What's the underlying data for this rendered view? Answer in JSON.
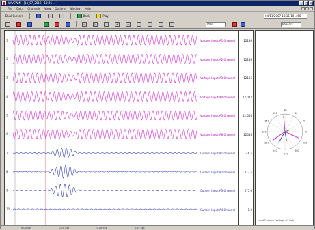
{
  "app": {
    "title": "WAVEWIN - [11_07_2012 - 18:25 ... ]"
  },
  "menu": [
    "File",
    "Calcs",
    "Channels",
    "View",
    "Options",
    "Window",
    "Help"
  ],
  "toolbar1": {
    "left_label": "Dual Cursors",
    "right_field": "04/11/2007  18:15:10 .456",
    "btn_a": "Back",
    "btn_b": "Play"
  },
  "toolbar2": {
    "combo_a": "Vals",
    "combo_b": "Phasors"
  },
  "channels": [
    {
      "label": "Voltage Input A1 Channel",
      "value": "12136",
      "kind": "voltage"
    },
    {
      "label": "Voltage Input A2 Channel",
      "value": "12136",
      "kind": "voltage"
    },
    {
      "label": "Voltage Input A3 Channel",
      "value": "12136",
      "kind": "voltage"
    },
    {
      "label": "Voltage Input A4 Channel",
      "value": "12,072",
      "kind": "voltage"
    },
    {
      "label": "Voltage Input A5 Channel",
      "value": "12,064",
      "kind": "voltage"
    },
    {
      "label": "Voltage Input A6 Channel",
      "value": "12054",
      "kind": "voltage"
    },
    {
      "label": "Current Input A1 Channel",
      "value": "46.5",
      "kind": "current"
    },
    {
      "label": "Current Input A2 Channel",
      "value": "373.5",
      "kind": "current"
    },
    {
      "label": "Current Input A3 Channel",
      "value": "375.6",
      "kind": "current"
    },
    {
      "label": "Current Input A4 Channel",
      "value": "1.0",
      "kind": "current"
    }
  ],
  "phasor": {
    "angles": [
      "0",
      "30",
      "60",
      "90",
      "120",
      "150",
      "180",
      "210",
      "240",
      "270",
      "300",
      "330"
    ],
    "caption": "Input Phasors (Voltage A1 Ref)"
  },
  "status": [
    "0.00 Sec",
    "0.05 Sec",
    "0.10 Sec",
    "0.15 Sec"
  ],
  "colors": {
    "voltage": "#d030d0",
    "current": "#3040b0",
    "titlebar": "#0a246a",
    "cursor": "#d00000"
  }
}
